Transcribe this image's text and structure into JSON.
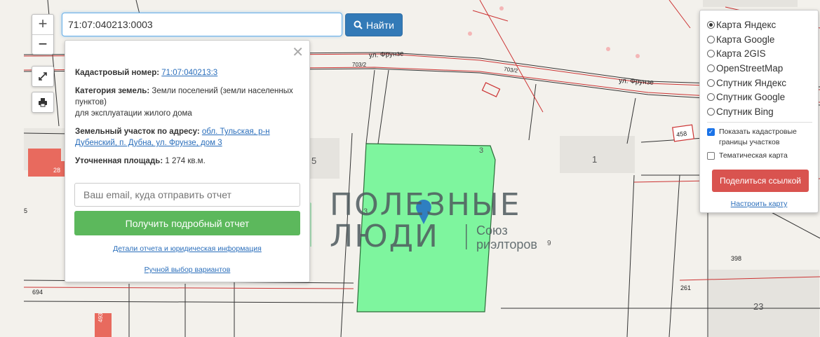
{
  "search": {
    "value": "71:07:040213:0003",
    "button_label": "Найти"
  },
  "zoom": {
    "in": "+",
    "out": "−"
  },
  "map_labels": {
    "street_1": "ул. Фрунзе",
    "street_2": "ул. Фрунзе",
    "lot_703_a": "703/2",
    "lot_703_b": "703/2",
    "num_458": "458",
    "num_1": "1",
    "num_5": "5",
    "num_3": "3",
    "num_3b": "3",
    "num_28": "28",
    "num_694": "694",
    "num_493": "493",
    "num_9": "9",
    "num_398": "398",
    "num_261": "261",
    "num_23": "23",
    "num_side": "5"
  },
  "panel": {
    "cadastral_label": "Кадастровый номер:",
    "cadastral_value": "71:07:040213:3",
    "category_label": "Категория земель:",
    "category_value": "Земли поселений (земли населенных пунктов)",
    "usage": "для эксплуатации жилого дома",
    "address_label": "Земельный участок по адресу:",
    "address_value": "обл. Тульская, р-н Дубенский, п. Дубна, ул. Фрунзе, дом 3",
    "area_label": "Уточненная площадь:",
    "area_value": "1 274 кв.м.",
    "email_placeholder": "Ваш email, куда отправить отчет",
    "report_button": "Получить подробный отчет",
    "details_link": "Детали отчета и юридическая информация",
    "manual_link": "Ручной выбор вариантов"
  },
  "layers": {
    "options": [
      "Карта Яндекс",
      "Карта Google",
      "Карта 2GIS",
      "OpenStreetMap",
      "Спутник Яндекс",
      "Спутник Google",
      "Спутник Bing"
    ],
    "selected": "Карта Яндекс",
    "show_borders": "Показать кадастровые границы участков",
    "thematic": "Тематическая карта",
    "share_button": "Поделиться ссылкой",
    "setup_link": "Настроить карту"
  },
  "watermark": {
    "line1": "ПОЛЕЗНЫЕ",
    "line2": "ЛЮДИ",
    "sub1": "Союз",
    "sub2": "риэлторов"
  },
  "colors": {
    "parcel": "#7ef59e",
    "accent": "#337ab7",
    "report": "#5cb85c",
    "share": "#d9534f",
    "building": "#e86a5e"
  }
}
